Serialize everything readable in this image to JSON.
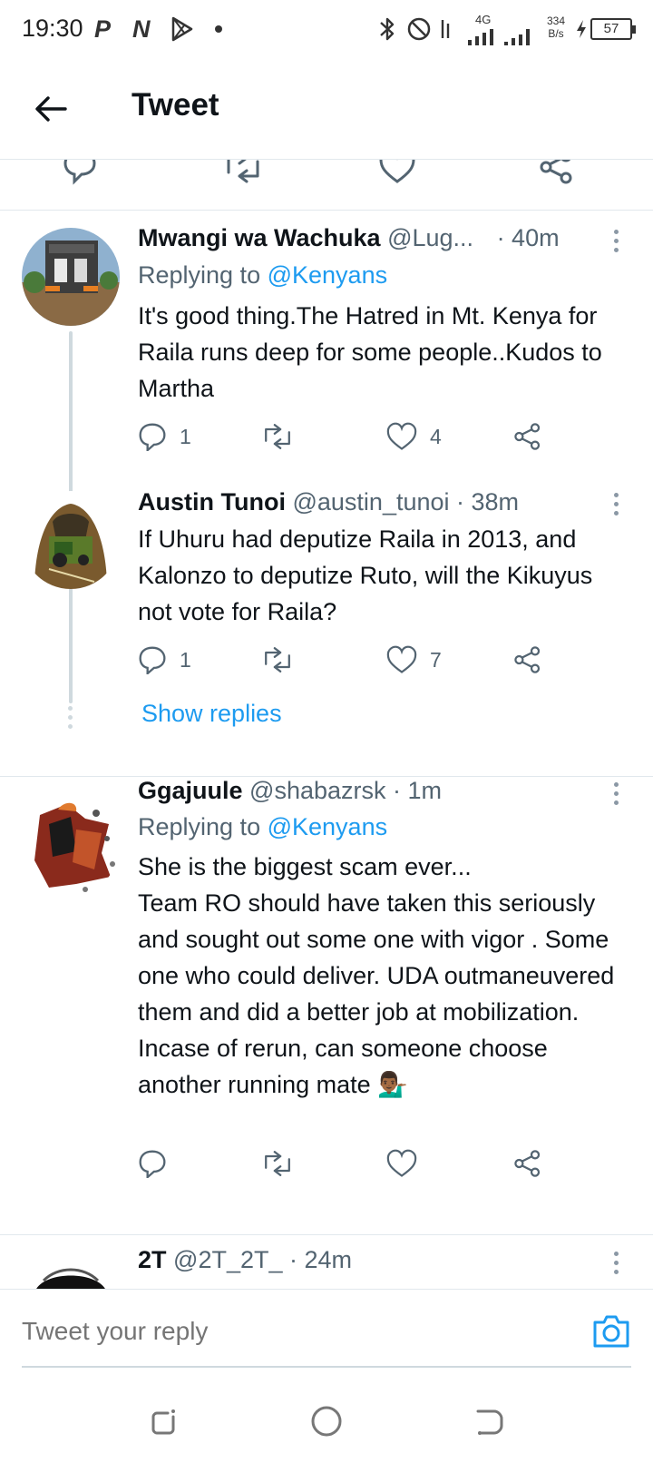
{
  "status_bar": {
    "time": "19:30",
    "network": "4G",
    "speed_value": "334",
    "speed_unit": "B/s",
    "battery": "57",
    "notification_icons": [
      "p-app-icon",
      "n-app-icon",
      "play-store-icon",
      "dot-icon"
    ],
    "system_icons": [
      "bluetooth-icon",
      "do-not-disturb-icon",
      "signal-icon",
      "charging-icon"
    ]
  },
  "header": {
    "title": "Tweet",
    "back_icon": "back-arrow-icon"
  },
  "tweets": [
    {
      "display_name": "Mwangi wa Wachuka",
      "handle": "@Lug...",
      "time": "· 40m",
      "replying_prefix": "Replying to",
      "replying_to": "@Kenyans",
      "text": "It's good thing.The Hatred in Mt. Kenya for Raila runs deep for some people..Kudos to Martha",
      "replies": "1",
      "retweets": "",
      "likes": "4"
    },
    {
      "display_name": "Austin Tunoi",
      "handle": "@austin_tunoi",
      "time": "· 38m",
      "text": "If Uhuru had deputize Raila in 2013, and Kalonzo to deputize Ruto, will the Kikuyus not vote for Raila?",
      "replies": "1",
      "retweets": "",
      "likes": "7",
      "show_replies": "Show replies"
    },
    {
      "display_name": "Ggajuule",
      "handle": "@shabazrsk",
      "time": "· 1m",
      "replying_prefix": "Replying to",
      "replying_to": "@Kenyans",
      "text": "She is the biggest scam ever...\nTeam RO should have taken this seriously and sought out some one with vigor . Some one who could deliver. UDA outmaneuvered them and did a better job at mobilization.\nIncase of rerun, can someone choose another running mate 💁🏾‍♂️",
      "replies": "",
      "retweets": "",
      "likes": ""
    },
    {
      "display_name": "2T",
      "handle": "@2T_2T_",
      "time": "· 24m"
    }
  ],
  "reply_bar": {
    "placeholder": "Tweet your reply",
    "camera_icon": "camera-icon"
  },
  "nav_bar": {
    "icons": [
      "recents-icon",
      "home-icon",
      "back-icon"
    ]
  },
  "colors": {
    "link": "#1d9bf0",
    "secondary_text": "#536471",
    "divider": "#e1e8ed"
  }
}
